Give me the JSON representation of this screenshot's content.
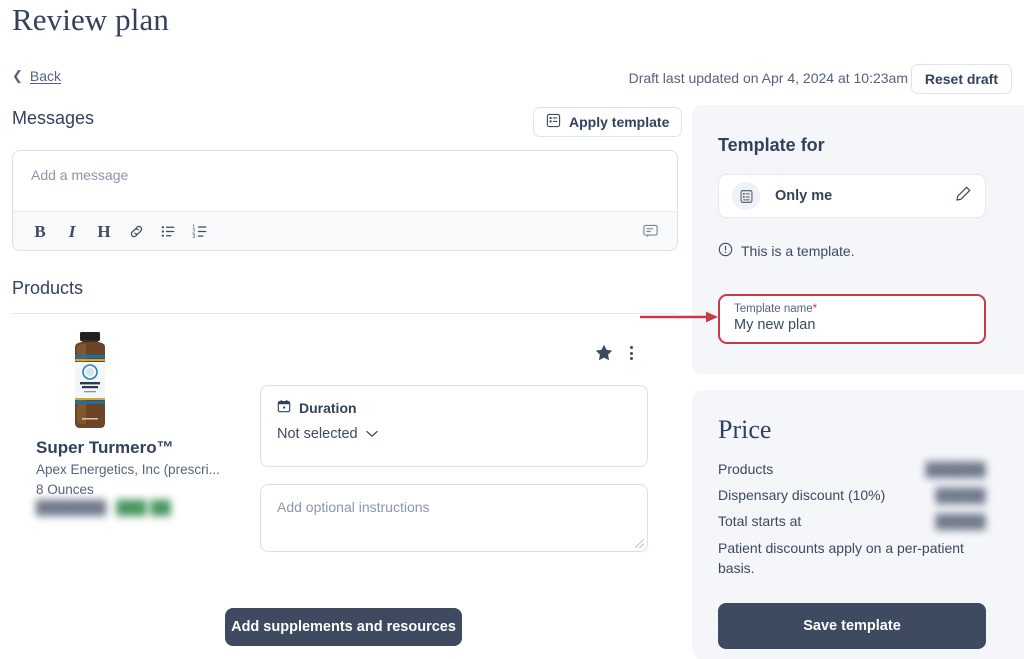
{
  "page": {
    "title": "Review plan"
  },
  "topbar": {
    "back_label": "Back",
    "back_icon": "chevron-left-icon",
    "draft_status": "Draft last updated on Apr 4, 2024 at 10:23am",
    "reset_label": "Reset draft"
  },
  "messages": {
    "heading": "Messages",
    "apply_template_label": "Apply template",
    "apply_template_icon": "template-list-icon",
    "editor_placeholder": "Add a message",
    "toolbar": [
      {
        "name": "bold-button",
        "glyph": "B"
      },
      {
        "name": "italic-button",
        "glyph": "I"
      },
      {
        "name": "heading-button",
        "glyph": "H"
      },
      {
        "name": "link-button",
        "glyph": "link-icon"
      },
      {
        "name": "bulleted-list-button",
        "glyph": "bullet-list-icon"
      },
      {
        "name": "numbered-list-button",
        "glyph": "numbered-list-icon"
      }
    ],
    "comment_icon": "comment-bubble-icon"
  },
  "products": {
    "heading": "Products",
    "item": {
      "name": "Super Turmero™",
      "brand": "Apex Energetics, Inc (prescri...",
      "size": "8 Ounces",
      "price_masked": "███████",
      "discount_masked": "███ ██",
      "favorite_icon": "star-filled-icon",
      "menu_icon": "kebab-menu-icon",
      "duration_label": "Duration",
      "duration_icon": "calendar-icon",
      "duration_value": "Not selected",
      "instructions_placeholder": "Add optional instructions"
    },
    "add_button_label": "Add supplements and resources"
  },
  "sidebar": {
    "template_for_heading": "Template for",
    "audience_label": "Only me",
    "audience_icon": "document-list-icon",
    "edit_icon": "pencil-icon",
    "note_icon": "info-circle-icon",
    "note_text": "This is a template.",
    "template_name_label": "Template name",
    "template_name_required_mark": "*",
    "template_name_value": "My new plan",
    "price": {
      "heading": "Price",
      "rows": [
        {
          "label": "Products",
          "value_masked": "██████"
        },
        {
          "label": "Dispensary discount (10%)",
          "value_masked": "█████"
        },
        {
          "label": "Total starts at",
          "value_masked": "█████"
        }
      ],
      "note": "Patient discounts apply on a per-patient basis.",
      "save_label": "Save template"
    }
  },
  "colors": {
    "accent_dark": "#3d4a60",
    "panel_bg": "#f4f6fa",
    "required_red": "#c9394a",
    "annotation_red": "#c9394a",
    "text": "#3c4a5e"
  }
}
